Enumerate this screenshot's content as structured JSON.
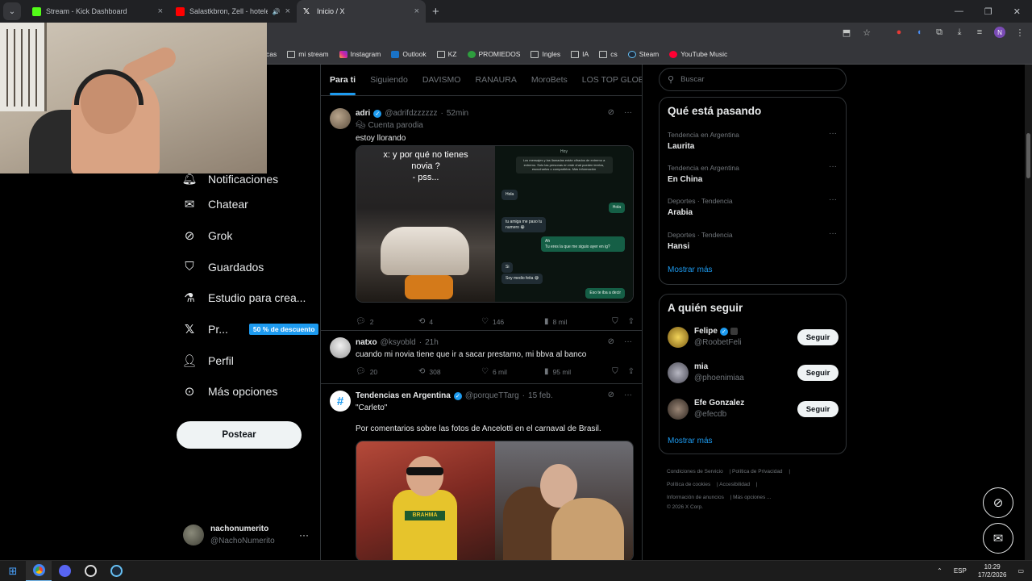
{
  "browser": {
    "tabs": [
      {
        "title": "Stream - Kick Dashboard",
        "favicon_color": "#53fc18"
      },
      {
        "title": "Salastkbron, Zell - hoteles (",
        "favicon_color": "#ff0000"
      },
      {
        "title": "Inicio / X",
        "favicon_color": "#ffffff"
      }
    ],
    "bookmarks": [
      {
        "label": "cas",
        "icon": "folder-icon"
      },
      {
        "label": "mi stream",
        "icon": "folder-icon"
      },
      {
        "label": "Instagram",
        "icon": "instagram-icon"
      },
      {
        "label": "Outlook",
        "icon": "outlook-icon"
      },
      {
        "label": "KZ",
        "icon": "folder-icon"
      },
      {
        "label": "PROMIEDOS",
        "icon": "promiedos-icon"
      },
      {
        "label": "Ingles",
        "icon": "folder-icon"
      },
      {
        "label": "IA",
        "icon": "folder-icon"
      },
      {
        "label": "cs",
        "icon": "folder-icon"
      },
      {
        "label": "Steam",
        "icon": "steam-icon"
      },
      {
        "label": "YouTube Music",
        "icon": "youtube-music-icon"
      }
    ],
    "profile_initial": "N"
  },
  "nav": {
    "items": [
      {
        "label": "Notificaciones",
        "icon": "bell-icon"
      },
      {
        "label": "Chatear",
        "icon": "mail-icon"
      },
      {
        "label": "Grok",
        "icon": "grok-icon"
      },
      {
        "label": "Guardados",
        "icon": "bookmark-icon"
      },
      {
        "label": "Estudio para crea...",
        "icon": "creator-studio-icon"
      },
      {
        "label": "Pr...",
        "icon": "x-premium-icon",
        "badge": "50 % de descuento"
      },
      {
        "label": "Perfil",
        "icon": "person-icon"
      },
      {
        "label": "Más opciones",
        "icon": "more-circle-icon"
      }
    ],
    "post_button": "Postear",
    "account": {
      "name": "nachonumerito",
      "handle": "@NachoNumerito"
    }
  },
  "timeline": {
    "tabs": [
      "Para ti",
      "Siguiendo",
      "DAVISMO",
      "RANAURA",
      "MoroBets",
      "LOS TOP GLOBA"
    ],
    "tweets": [
      {
        "name": "adri",
        "handle": "@adrifdzzzzzz",
        "time": "52min",
        "badge": "Cuenta parodia",
        "text": "estoy llorando",
        "media_caption": "x: y por qué no tienes\nnovia ?\n- pss...",
        "chat": {
          "header": "Hoy",
          "system": "Los mensajes y las llamadas están cifrados de extremo a extremo. Solo las personas en este chat pueden leerlos, escucharlos o compartirlos. Más información",
          "messages": [
            "Hola",
            "Hola",
            "tu amiga me paso tu\nnumero 😁",
            "Ah\nTu eres la que me siguio ayer en ig?",
            "Si",
            "Soy medio feita 😅",
            "Eso te iba a decir"
          ]
        },
        "replies": "2",
        "reposts": "4",
        "likes": "146",
        "views": "8 mil"
      },
      {
        "name": "natxo",
        "handle": "@ksyobld",
        "time": "21h",
        "text": "cuando mi novia tiene que ir a sacar prestamo, mi bbva al banco",
        "replies": "20",
        "reposts": "308",
        "likes": "6 mil",
        "views": "95 mil"
      },
      {
        "name": "Tendencias en Argentina",
        "handle": "@porqueTTarg",
        "time": "15 feb.",
        "text": "\"Carleto\"",
        "text2": "Por comentarios sobre las fotos de Ancelotti en el carnaval de Brasil.",
        "shirt_logo": "BRAHMA"
      }
    ]
  },
  "sidebar": {
    "search_placeholder": "Buscar",
    "trends_title": "Qué está pasando",
    "trends": [
      {
        "context": "Tendencia en Argentina",
        "name": "Laurita"
      },
      {
        "context": "Tendencia en Argentina",
        "name": "En China"
      },
      {
        "context": "Deportes · Tendencia",
        "name": "Arabia"
      },
      {
        "context": "Deportes · Tendencia",
        "name": "Hansi"
      }
    ],
    "show_more": "Mostrar más",
    "follow_title": "A quién seguir",
    "follow": [
      {
        "name": "Felipe",
        "handle": "@RoobetFeli",
        "avatar_color": "#d4b12a"
      },
      {
        "name": "mia",
        "handle": "@phoenimiaa",
        "avatar_color": "#8d8d96"
      },
      {
        "name": "Efe Gonzalez",
        "handle": "@efecdb",
        "avatar_color": "#5a4a3e"
      }
    ],
    "follow_button": "Seguir",
    "show_more_2": "Mostrar más",
    "footer": [
      "Condiciones de Servicio",
      "Política de Privacidad",
      "Política de cookies",
      "Accesibilidad",
      "Información de anuncios",
      "Más opciones ...",
      "© 2026 X Corp."
    ]
  },
  "taskbar": {
    "lang": "ESP",
    "time": "10:29",
    "date": "17/2/2026"
  },
  "colors": {
    "accent": "#1d9bf0",
    "background": "#000000",
    "border": "#2f3336"
  }
}
